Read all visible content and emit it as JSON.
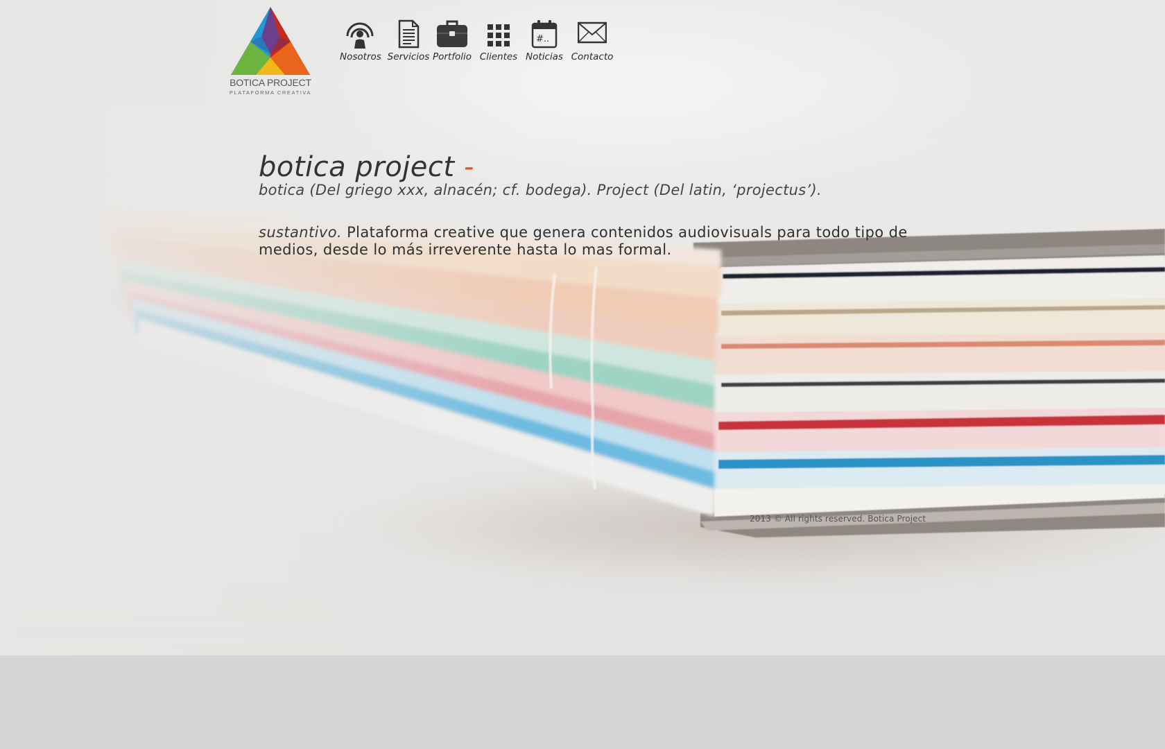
{
  "logo": {
    "name": "BOTICA PROJECT",
    "tagline": "PLATAFORMA CREATIVA",
    "colors": [
      "#6a3f8c",
      "#1f9ad6",
      "#c8281d",
      "#f0b81b",
      "#6db33f",
      "#e8651b"
    ]
  },
  "nav": [
    {
      "label": "Nosotros",
      "icon": "podcast-person-icon"
    },
    {
      "label": "Servicios",
      "icon": "document-icon"
    },
    {
      "label": "Portfolio",
      "icon": "briefcase-icon"
    },
    {
      "label": "Clientes",
      "icon": "grid-icon"
    },
    {
      "label": "Noticias",
      "icon": "calendar-hashtag-icon"
    },
    {
      "label": "Contacto",
      "icon": "envelope-icon"
    }
  ],
  "content": {
    "title": "botica project",
    "title_dash": "-",
    "etymology": "botica (Del griego xxx, alnacén; cf. bodega). Project (Del latin, ‘projectus’).",
    "part_of_speech": "sustantivo.",
    "definition": "Plataforma creative que genera contenidos audiovisuals para todo tipo de medios, desde lo más irreverente hasta lo mas formal."
  },
  "footer": {
    "copyright": "2013 © All rights reserved. Botica Project"
  },
  "colors": {
    "accent": "#e2561c",
    "page_bottom": "#d6d5d4"
  }
}
